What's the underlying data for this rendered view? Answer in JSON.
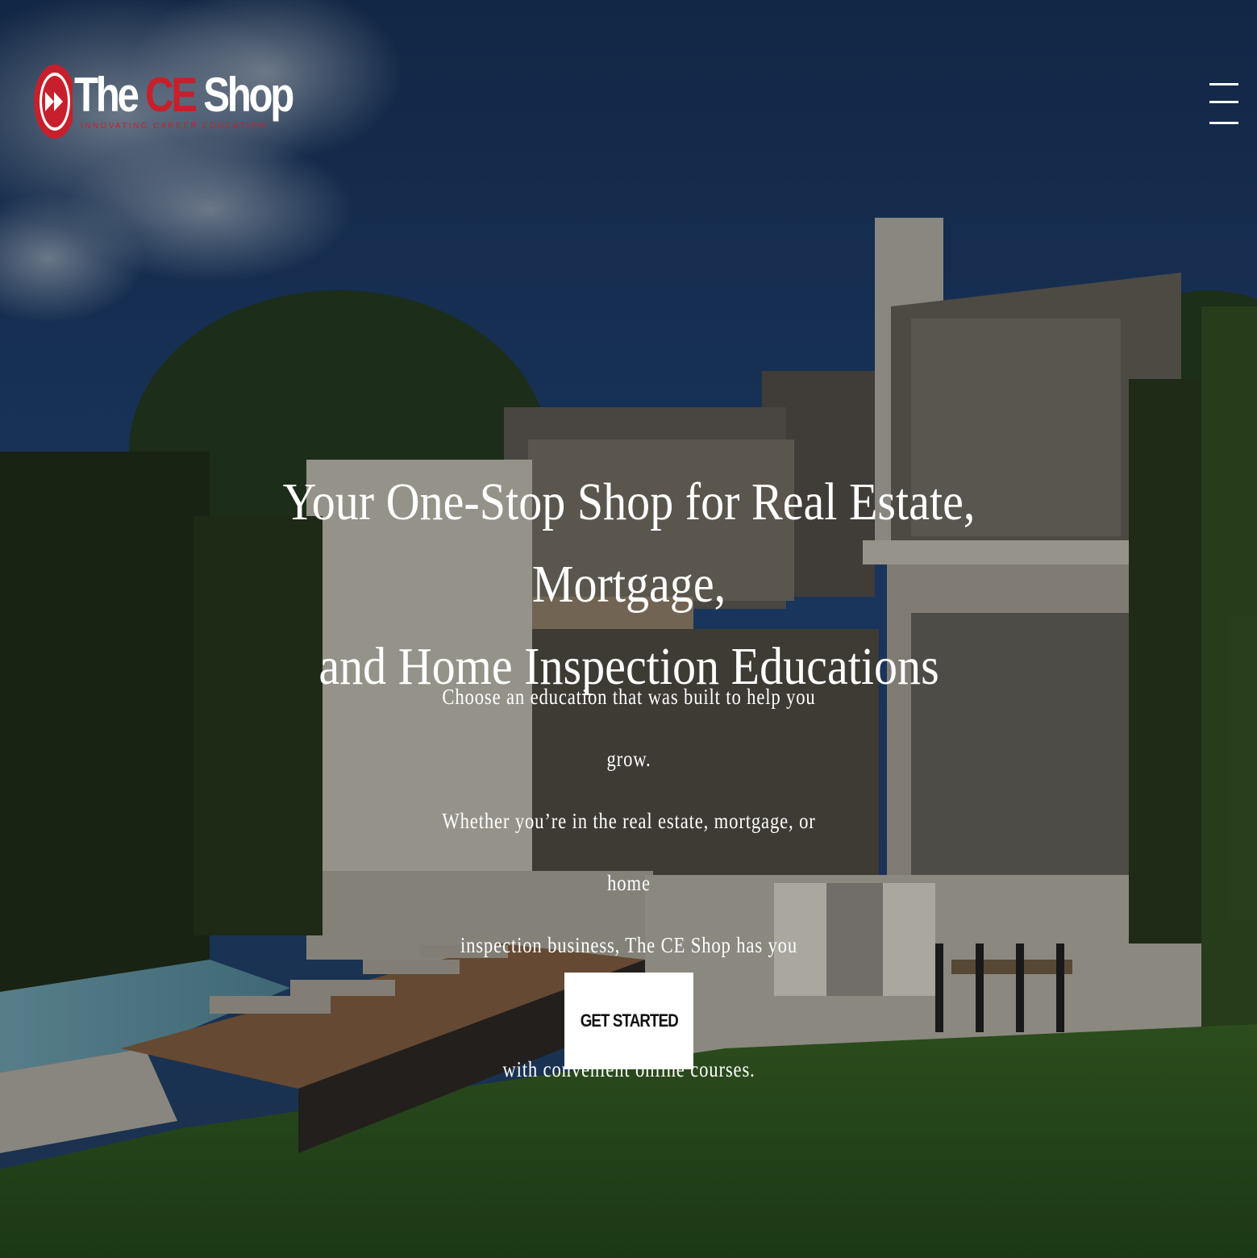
{
  "logo": {
    "brand_prefix": "The",
    "brand_highlight": "CE",
    "brand_suffix": "Shop",
    "tagline": "INNOVATING CAREER EDUCATION",
    "accent_color": "#c7202c",
    "icon": "fast-forward-icon"
  },
  "nav": {
    "menu_icon": "hamburger-menu-icon"
  },
  "hero": {
    "headline_line1": "Your One-Stop Shop for Real Estate, Mortgage,",
    "headline_line2": "and Home Inspection Educations",
    "sub_line1": "Choose an education that was built to help you grow.",
    "sub_line2": "Whether you’re in the real estate, mortgage, or home",
    "sub_line3": "inspection business, The CE Shop has you covered",
    "sub_line4": "with convenient online courses.",
    "cta_label": "GET STARTED"
  }
}
